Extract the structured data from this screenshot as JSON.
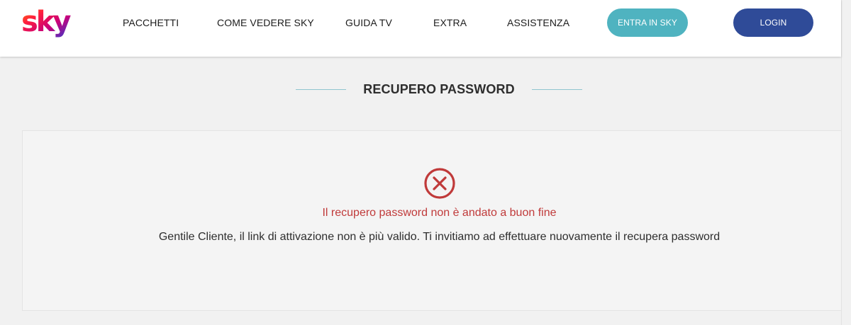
{
  "header": {
    "logo_text": "sky",
    "nav": [
      "PACCHETTI",
      "COME VEDERE SKY",
      "GUIDA TV",
      "EXTRA",
      "ASSISTENZA"
    ],
    "entra_label": "ENTRA IN SKY",
    "login_label": "LOGIN"
  },
  "page": {
    "section_title": "RECUPERO PASSWORD"
  },
  "error": {
    "icon": "error-x-circle-icon",
    "title": "Il recupero password non è andato a buon fine",
    "message": "Gentile Cliente, il link di attivazione non è più valido. Ti invitiamo ad effettuare nuovamente il recupera password"
  },
  "colors": {
    "entra_button": "#4fb3c0",
    "login_button": "#2f4b98",
    "error_red": "#c03a3a",
    "title_rule": "#8fc4cf"
  }
}
